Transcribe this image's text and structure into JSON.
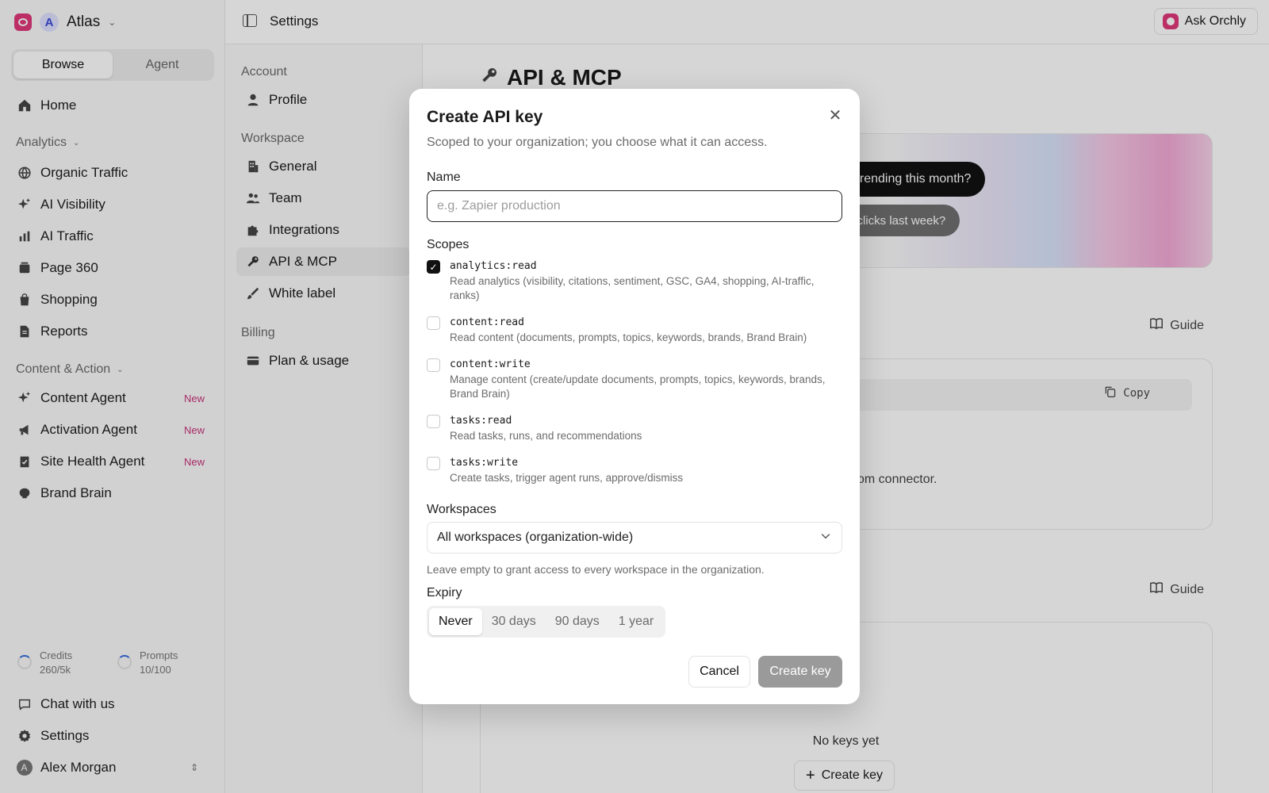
{
  "workspace": {
    "name": "Atlas",
    "initial": "A"
  },
  "sidebar": {
    "tabs": [
      "Browse",
      "Agent"
    ],
    "home": "Home",
    "analytics_label": "Analytics",
    "analytics_items": [
      "Organic Traffic",
      "AI Visibility",
      "AI Traffic",
      "Page 360",
      "Shopping",
      "Reports"
    ],
    "content_label": "Content & Action",
    "content_items": [
      {
        "label": "Content Agent",
        "badge": "New"
      },
      {
        "label": "Activation Agent",
        "badge": "New"
      },
      {
        "label": "Site Health Agent",
        "badge": "New"
      },
      {
        "label": "Brand Brain",
        "badge": ""
      }
    ],
    "credits": {
      "label": "Credits",
      "value": "260/5k"
    },
    "prompts": {
      "label": "Prompts",
      "value": "10/100"
    },
    "chat": "Chat with us",
    "settings": "Settings",
    "user": {
      "name": "Alex Morgan",
      "initial": "A"
    }
  },
  "topbar": {
    "title": "Settings",
    "ask": "Ask Orchly"
  },
  "settings_nav": {
    "account_label": "Account",
    "account_items": [
      "Profile"
    ],
    "workspace_label": "Workspace",
    "workspace_items": [
      "General",
      "Team",
      "Integrations",
      "API & MCP",
      "White label"
    ],
    "billing_label": "Billing",
    "billing_items": [
      "Plan & usage"
    ]
  },
  "main": {
    "title": "API & MCP",
    "prompt1": "bility trending this month?",
    "prompt2": "lost clicks last week?",
    "guide": "Guide",
    "copy": "Copy",
    "connector": "om connector.",
    "empty": "No keys yet",
    "create": "Create key"
  },
  "modal": {
    "title": "Create API key",
    "subtitle": "Scoped to your organization; you choose what it can access.",
    "name_label": "Name",
    "name_placeholder": "e.g. Zapier production",
    "scopes_label": "Scopes",
    "scopes": [
      {
        "code": "analytics:read",
        "desc": "Read analytics (visibility, citations, sentiment, GSC, GA4, shopping, AI-traffic, ranks)",
        "checked": true
      },
      {
        "code": "content:read",
        "desc": "Read content (documents, prompts, topics, keywords, brands, Brand Brain)",
        "checked": false
      },
      {
        "code": "content:write",
        "desc": "Manage content (create/update documents, prompts, topics, keywords, brands, Brand Brain)",
        "checked": false
      },
      {
        "code": "tasks:read",
        "desc": "Read tasks, runs, and recommendations",
        "checked": false
      },
      {
        "code": "tasks:write",
        "desc": "Create tasks, trigger agent runs, approve/dismiss",
        "checked": false
      }
    ],
    "workspaces_label": "Workspaces",
    "workspaces_value": "All workspaces (organization-wide)",
    "workspaces_hint": "Leave empty to grant access to every workspace in the organization.",
    "expiry_label": "Expiry",
    "expiry_options": [
      "Never",
      "30 days",
      "90 days",
      "1 year"
    ],
    "expiry_selected": "Never",
    "cancel": "Cancel",
    "submit": "Create key",
    "close_glyph": "✕",
    "check_glyph": "✓"
  },
  "colors": {
    "brand": "#e0397a",
    "badge_new": "#c8347c",
    "submit_disabled": "#9a9a9a"
  }
}
